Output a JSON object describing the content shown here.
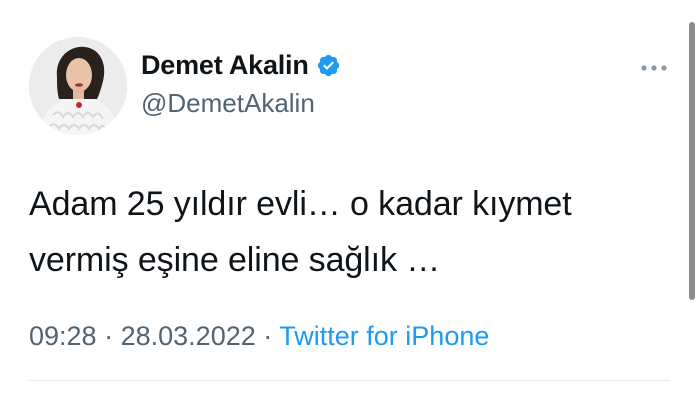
{
  "tweet": {
    "author": {
      "display_name": "Demet Akalin",
      "handle": "@DemetAkalin",
      "verified": true
    },
    "text_lines": [
      "Adam 25 yıldır evli… o kadar kıymet",
      "vermiş eşine eline sağlık …"
    ],
    "time": "09:28",
    "separator": "·",
    "date": "28.03.2022",
    "source": "Twitter for iPhone"
  },
  "icons": {
    "verified": "verified-badge-icon",
    "more": "more-options-icon"
  },
  "colors": {
    "text": "#0f1419",
    "secondary": "#536471",
    "link": "#1d9bf0",
    "verified": "#1d9bf0"
  }
}
